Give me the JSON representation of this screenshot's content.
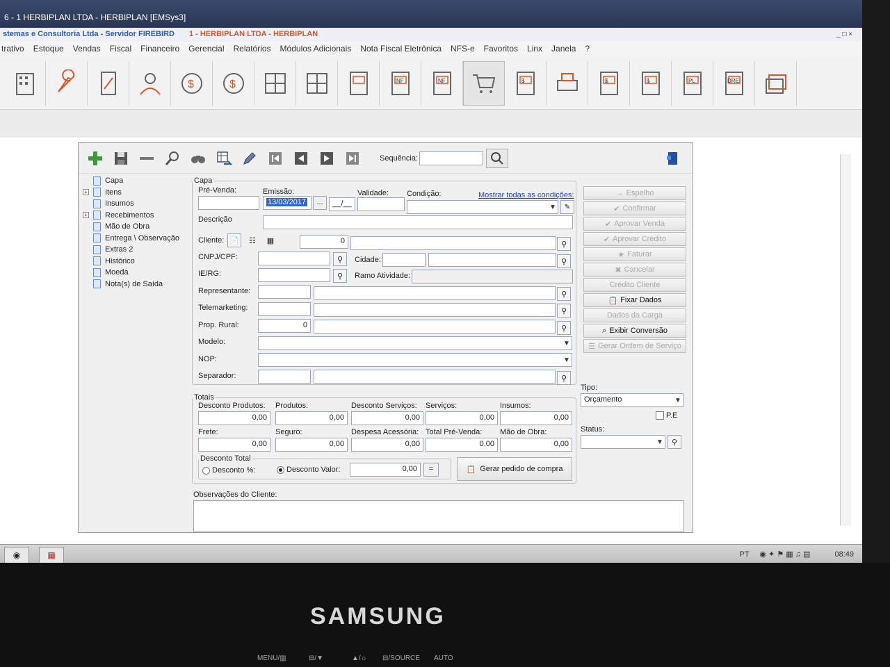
{
  "window": {
    "title": "6 - 1    HERBIPLAN LTDA - HERBIPLAN [EMSys3]",
    "subtitle_a": "stemas e Consultoria Ltda - Servidor FIREBIRD",
    "subtitle_b": "1 - HERBIPLAN LTDA - HERBIPLAN",
    "controls": "_ □ ×"
  },
  "menu": [
    "trativo",
    "Estoque",
    "Vendas",
    "Fiscal",
    "Financeiro",
    "Gerencial",
    "Relatórios",
    "Módulos Adicionais",
    "Nota Fiscal Eletrônica",
    "NFS-e",
    "Favoritos",
    "Linx",
    "Janela",
    "?"
  ],
  "toolbar_icons": [
    "building-icon",
    "wrench-icon",
    "document-icon",
    "user-icon",
    "money-minus-icon",
    "money-plus-icon",
    "grid-icon",
    "grid-clock-icon",
    "list-clock-icon",
    "nf-in-icon",
    "nf-out-icon",
    "cart-icon",
    "receipt-minus-icon",
    "printer-icon",
    "receipt-plus-icon",
    "receipt-list-icon",
    "pl-icon",
    "dre-icon",
    "folders-icon"
  ],
  "icons": {
    "nf": "NF",
    "pl": "PL",
    "dre": "DRE",
    "dollar": "$"
  },
  "form_toolbar": {
    "sequence_label": "Sequência:"
  },
  "tree": [
    {
      "label": "Capa",
      "expand": false
    },
    {
      "label": "Itens",
      "expand": true
    },
    {
      "label": "Insumos",
      "expand": false
    },
    {
      "label": "Recebimentos",
      "expand": true
    },
    {
      "label": "Mão de Obra",
      "expand": false
    },
    {
      "label": "Entrega \\ Observação",
      "expand": false
    },
    {
      "label": "Extras 2",
      "expand": false
    },
    {
      "label": "Histórico",
      "expand": false
    },
    {
      "label": "Moeda",
      "expand": false
    },
    {
      "label": "Nota(s) de Saída",
      "expand": false
    }
  ],
  "capa": {
    "legend": "Capa",
    "pre_venda": "Pré-Venda:",
    "emissao": "Emissão:",
    "emissao_value": "13/03/2017",
    "date_btn": "...",
    "blank_date": "__/__",
    "validade": "Validade:",
    "condicao": "Condição:",
    "mostrar": "Mostrar todas as condições:",
    "descricao": "Descrição",
    "cliente": "Cliente:",
    "cliente_code": "0",
    "cnpj": "CNPJ/CPF:",
    "cidade": "Cidade:",
    "ierg": "IE/RG:",
    "ramo": "Ramo Atividade:",
    "representante": "Representante:",
    "telemarketing": "Telemarketing:",
    "prop_rural": "Prop. Rural:",
    "prop_rural_value": "0",
    "modelo": "Modelo:",
    "nop": "NOP:",
    "separador": "Separador:"
  },
  "actions": [
    {
      "label": "Espelho",
      "enabled": false
    },
    {
      "label": "Confirmar",
      "enabled": false
    },
    {
      "label": "Aprovar Venda",
      "enabled": false
    },
    {
      "label": "Aprovar Crédito",
      "enabled": false
    },
    {
      "label": "Faturar",
      "enabled": false
    },
    {
      "label": "Cancelar",
      "enabled": false
    },
    {
      "label": "Crédito Cliente",
      "enabled": false
    },
    {
      "label": "Fixar Dados",
      "enabled": true
    },
    {
      "label": "Dados da Carga",
      "enabled": false
    },
    {
      "label": "Exibir Conversão",
      "enabled": true
    },
    {
      "label": "Gerar Ordem de Serviço",
      "enabled": false
    }
  ],
  "tipo": {
    "label": "Tipo:",
    "value": "Orçamento",
    "pe": "P.E"
  },
  "status": {
    "label": "Status:"
  },
  "totais": {
    "legend": "Totais",
    "row1": [
      {
        "label": "Desconto Produtos:",
        "value": "0,00"
      },
      {
        "label": "Produtos:",
        "value": "0,00"
      },
      {
        "label": "Desconto Serviços:",
        "value": "0,00"
      },
      {
        "label": "Serviços:",
        "value": "0,00"
      },
      {
        "label": "Insumos:",
        "value": "0,00"
      }
    ],
    "row2": [
      {
        "label": "Frete:",
        "value": "0,00"
      },
      {
        "label": "Seguro:",
        "value": "0,00"
      },
      {
        "label": "Despesa Acessória:",
        "value": "0,00"
      },
      {
        "label": "Total Pré-Venda:",
        "value": "0,00"
      },
      {
        "label": "Mão de Obra:",
        "value": "0,00"
      }
    ],
    "desconto_legend": "Desconto Total",
    "desc_pct": "Desconto %:",
    "desc_val": "Desconto Valor:",
    "desc_value": "0,00",
    "eq": "=",
    "gerar": "Gerar pedido de compra"
  },
  "obs": {
    "label": "Observações do Cliente:"
  },
  "taskbar": {
    "lang": "PT",
    "time": "08:49"
  },
  "monitor": {
    "brand": "SAMSUNG",
    "buttons": [
      "MENU/▥",
      "⊟/▼",
      "▲/☼",
      "⊟/SOURCE",
      "AUTO"
    ]
  }
}
